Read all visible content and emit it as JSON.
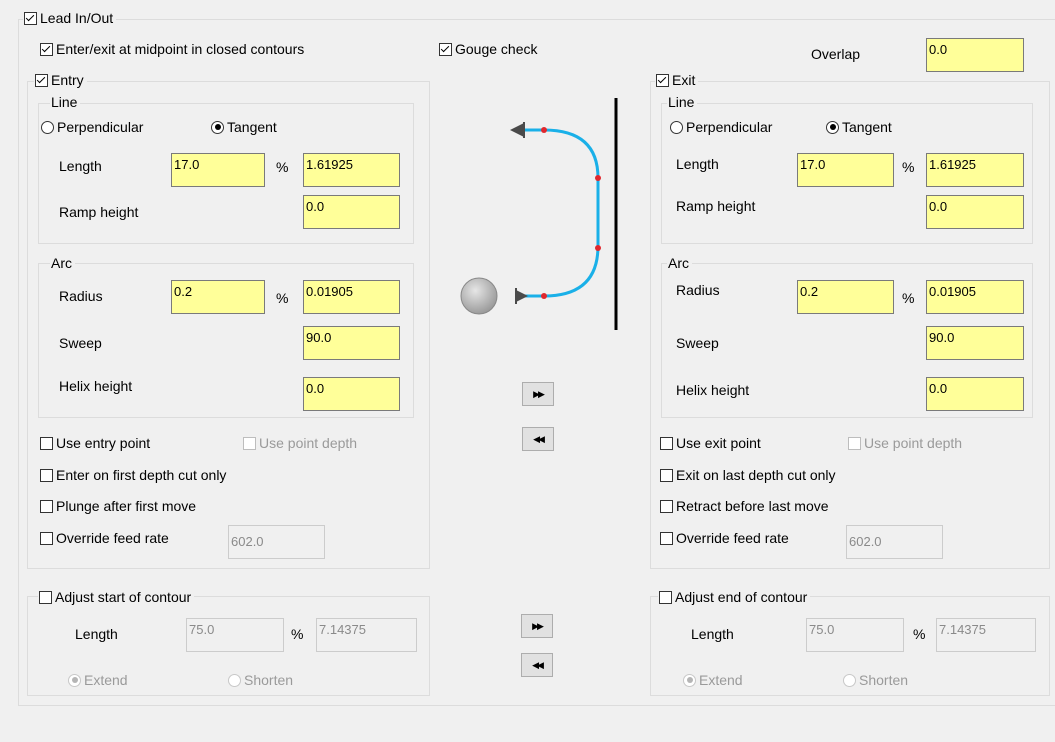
{
  "lead": {
    "title": "Lead In/Out",
    "midpoint_label": "Enter/exit at midpoint in closed contours",
    "gouge_label": "Gouge check",
    "overlap_label": "Overlap",
    "overlap_value": "0.0"
  },
  "entry": {
    "title": "Entry",
    "line_title": "Line",
    "perpendicular_label": "Perpendicular",
    "tangent_label": "Tangent",
    "length_label": "Length",
    "length_pct": "17.0",
    "pct_symbol": "%",
    "length_value": "1.61925",
    "ramp_label": "Ramp height",
    "ramp_value": "0.0",
    "arc_title": "Arc",
    "radius_label": "Radius",
    "radius_pct": "0.2",
    "radius_value": "0.01905",
    "sweep_label": "Sweep",
    "sweep_value": "90.0",
    "helix_label": "Helix height",
    "helix_value": "0.0",
    "use_point_label": "Use entry point",
    "use_depth_label": "Use point depth",
    "first_depth_label": "Enter on first depth cut only",
    "plunge_label": "Plunge after first move",
    "override_label": "Override feed rate",
    "override_value": "602.0"
  },
  "exit": {
    "title": "Exit",
    "line_title": "Line",
    "perpendicular_label": "Perpendicular",
    "tangent_label": "Tangent",
    "length_label": "Length",
    "length_pct": "17.0",
    "pct_symbol": "%",
    "length_value": "1.61925",
    "ramp_label": "Ramp height",
    "ramp_value": "0.0",
    "arc_title": "Arc",
    "radius_label": "Radius",
    "radius_pct": "0.2",
    "radius_value": "0.01905",
    "sweep_label": "Sweep",
    "sweep_value": "90.0",
    "helix_label": "Helix height",
    "helix_value": "0.0",
    "use_point_label": "Use exit point",
    "use_depth_label": "Use point depth",
    "last_depth_label": "Exit on last depth cut only",
    "retract_label": "Retract before last move",
    "override_label": "Override feed rate",
    "override_value": "602.0"
  },
  "adjust_start": {
    "title": "Adjust start of contour",
    "length_label": "Length",
    "length_pct": "75.0",
    "pct_symbol": "%",
    "length_value": "7.14375",
    "extend_label": "Extend",
    "shorten_label": "Shorten"
  },
  "adjust_end": {
    "title": "Adjust end of contour",
    "length_label": "Length",
    "length_pct": "75.0",
    "pct_symbol": "%",
    "length_value": "7.14375",
    "extend_label": "Extend",
    "shorten_label": "Shorten"
  },
  "buttons": {
    "copy_right_glyph": "▶▶",
    "copy_left_glyph": "◀◀"
  },
  "colors": {
    "field_yellow": "#ffff99",
    "toolpath_cyan": "#1ab0e8",
    "point_red": "#e0282e"
  },
  "icons": [
    "checkbox-icon",
    "radio-icon",
    "arrow-right-double-icon",
    "arrow-left-double-icon",
    "tool-ball-icon"
  ]
}
